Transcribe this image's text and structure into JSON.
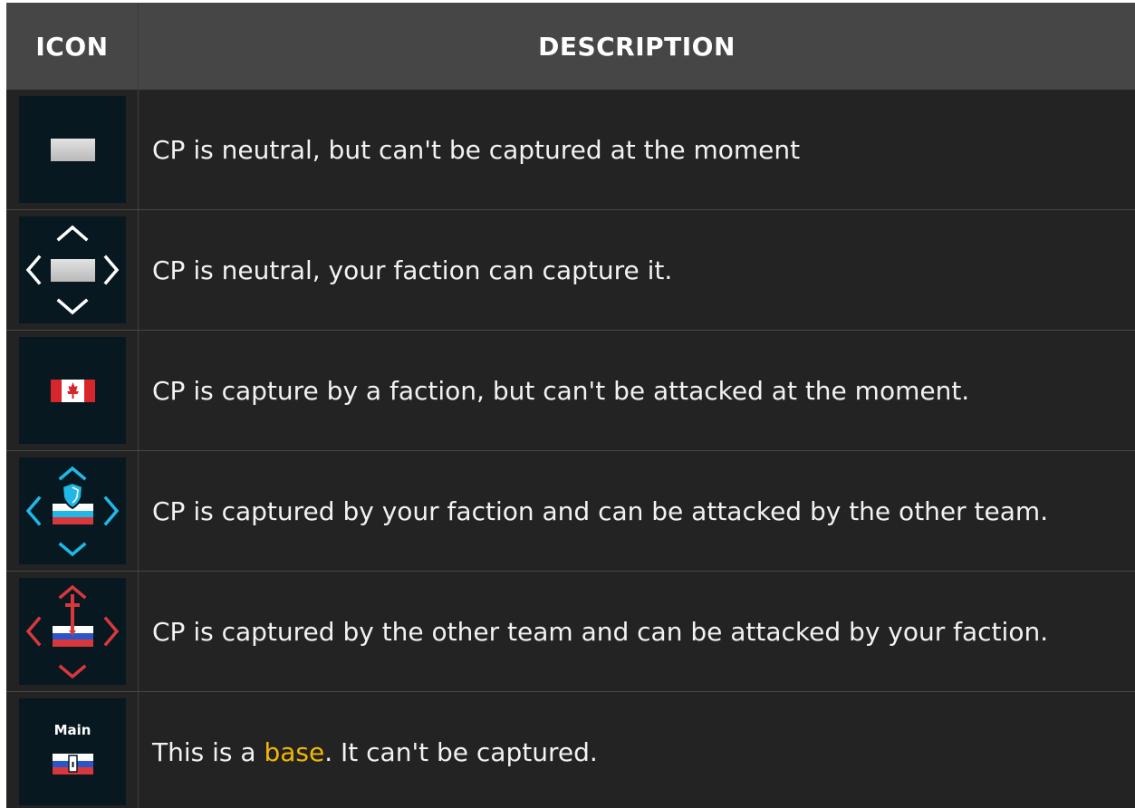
{
  "header": {
    "icon_label": "ICON",
    "description_label": "DESCRIPTION"
  },
  "rows": [
    {
      "icon": "neutral-locked-icon",
      "description": "CP is neutral, but can't be captured at the moment"
    },
    {
      "icon": "neutral-capturable-icon",
      "description": "CP is neutral, your faction can capture it."
    },
    {
      "icon": "canada-flag-locked-icon",
      "description": "CP is capture by a faction, but can't be attacked at the moment."
    },
    {
      "icon": "friendly-defend-icon",
      "description": "CP is captured by your faction and can be attacked by the other team."
    },
    {
      "icon": "enemy-attack-icon",
      "description": "CP is captured by the other team and can be attacked by your faction."
    },
    {
      "icon": "main-base-icon",
      "icon_label": "Main",
      "description_before": "This is a ",
      "description_link": "base",
      "description_after": ". It can't be captured."
    }
  ],
  "colors": {
    "table_background": "#232323",
    "header_background": "#464646",
    "icon_background": "#071820",
    "friendly": "#1fb8e8",
    "enemy": "#d8383b",
    "neutral": "#cfcfcf",
    "highlight": "#f2b705"
  }
}
